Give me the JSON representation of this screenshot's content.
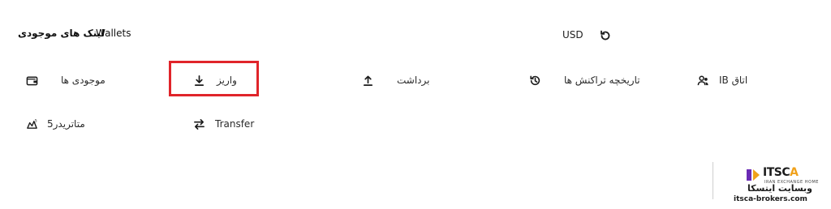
{
  "header": {
    "title_fa": "لینک های موجودی",
    "title_en": "Wallets",
    "currency": "USD",
    "refresh_icon": "refresh-icon"
  },
  "menu": {
    "balances": {
      "label": "موجودی ها",
      "icon": "wallet-icon"
    },
    "deposit": {
      "label": "واریز",
      "icon": "download-icon"
    },
    "withdraw": {
      "label": "برداشت",
      "icon": "upload-icon"
    },
    "history": {
      "label": "تاریخچه تراکنش ها",
      "icon": "history-icon"
    },
    "ib_room": {
      "label": "IB اتاق",
      "icon": "users-icon"
    },
    "metatrader": {
      "label": "متاتریدر5",
      "icon": "metatrader-icon"
    },
    "transfer": {
      "label": "Transfer",
      "icon": "transfer-icon"
    }
  },
  "highlight": {
    "color": "#e0242a",
    "target": "deposit"
  },
  "watermark": {
    "brand_prefix": "IT",
    "brand_mid": "SC",
    "brand_suffix": "A",
    "tagline": "IRAN EXCHANGE HOME",
    "name_fa": "وبسایت ایتسکا",
    "url": "itsca-brokers.com"
  }
}
